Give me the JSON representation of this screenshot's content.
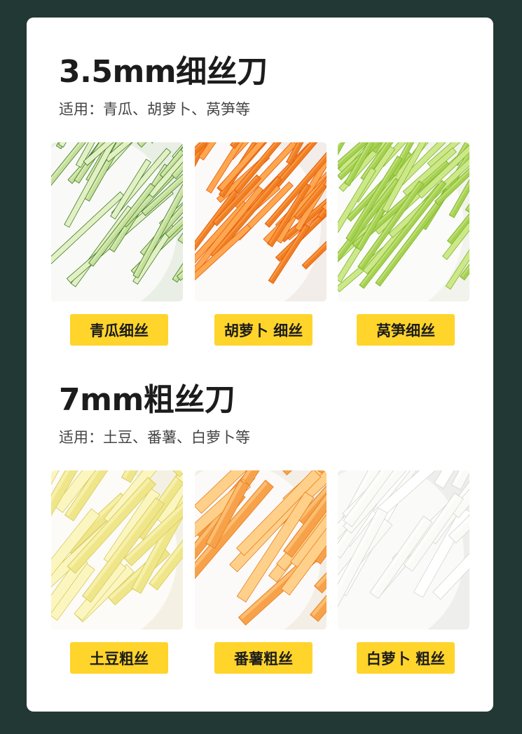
{
  "sections": [
    {
      "title": "3.5mm细丝刀",
      "subtitle": "适用：青瓜、胡萝卜、莴笋等",
      "items": [
        {
          "label": "青瓜细丝",
          "colors": {
            "bg": "#e9efe4",
            "strip": "#c5df9a",
            "edge": "#3f7a28",
            "light": "#e3f0c4"
          }
        },
        {
          "label": "胡萝卜 细丝",
          "colors": {
            "bg": "#f2ede8",
            "strip": "#f07f23",
            "edge": "#e25a10",
            "light": "#ffa74e"
          }
        },
        {
          "label": "莴笋细丝",
          "colors": {
            "bg": "#f2f3ec",
            "strip": "#a6d152",
            "edge": "#7fb52d",
            "light": "#cde889"
          }
        }
      ]
    },
    {
      "title": "7mm粗丝刀",
      "subtitle": "适用：土豆、番薯、白萝卜等",
      "items": [
        {
          "label": "土豆粗丝",
          "colors": {
            "bg": "#f4f1e4",
            "strip": "#efe68a",
            "edge": "#d9c95c",
            "light": "#fbf6c0"
          }
        },
        {
          "label": "番薯粗丝",
          "colors": {
            "bg": "#f4efe6",
            "strip": "#f7a24a",
            "edge": "#e57e22",
            "light": "#ffd08a"
          }
        },
        {
          "label": "白萝卜 粗丝",
          "colors": {
            "bg": "#eeeeec",
            "strip": "#fafaf7",
            "edge": "#d4d6cf",
            "light": "#ffffff"
          }
        }
      ]
    }
  ]
}
